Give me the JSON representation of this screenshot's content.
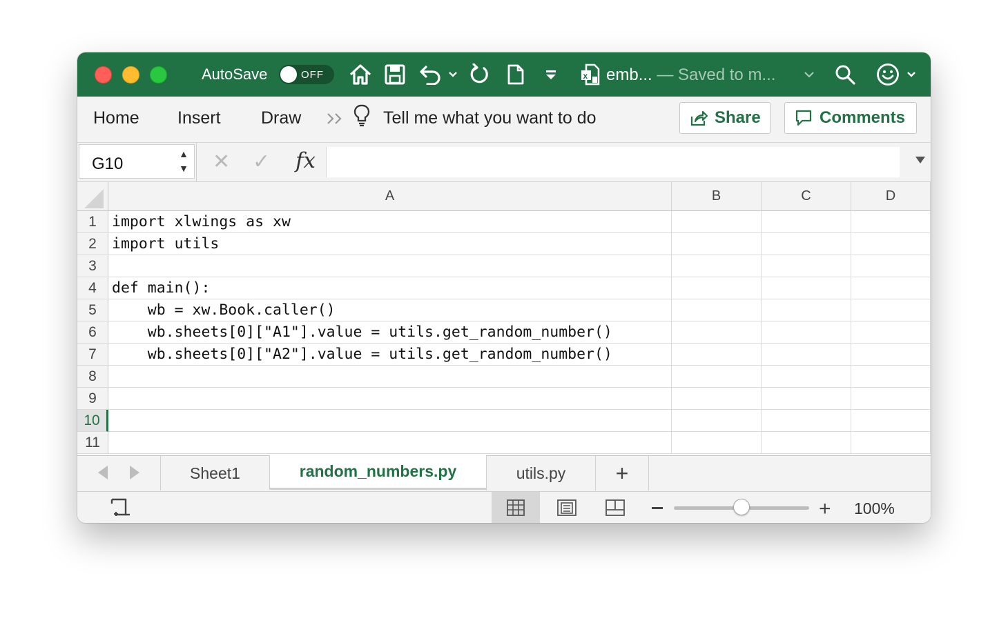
{
  "titlebar": {
    "autosave_label": "AutoSave",
    "autosave_state": "OFF",
    "doc_name": "emb...",
    "doc_status": " — Saved to m...",
    "icons": [
      "home-icon",
      "save-icon",
      "undo-icon",
      "redo-icon",
      "new-document-icon",
      "customize-toolbar-icon",
      "excel-file-icon",
      "search-icon",
      "smiley-feedback-icon"
    ]
  },
  "ribbon": {
    "tabs": [
      "Home",
      "Insert",
      "Draw"
    ],
    "tell_me": "Tell me what you want to do",
    "share_label": "Share",
    "comments_label": "Comments"
  },
  "formula_bar": {
    "name_box": "G10",
    "fx_label": "fx",
    "formula": ""
  },
  "grid": {
    "columns": [
      "A",
      "B",
      "C",
      "D"
    ],
    "rows": [
      "1",
      "2",
      "3",
      "4",
      "5",
      "6",
      "7",
      "8",
      "9",
      "10",
      "11"
    ],
    "selected_row": "10",
    "selected_cell": "G10",
    "cells_a": [
      "import xlwings as xw",
      "import utils",
      "",
      "def main():",
      "    wb = xw.Book.caller()",
      "    wb.sheets[0][\"A1\"].value = utils.get_random_number()",
      "    wb.sheets[0][\"A2\"].value = utils.get_random_number()",
      "",
      "",
      "",
      ""
    ]
  },
  "sheets": {
    "tabs": [
      "Sheet1",
      "random_numbers.py",
      "utils.py"
    ],
    "active": "random_numbers.py",
    "add_label": "+"
  },
  "statusbar": {
    "zoom": "100%",
    "zoom_value": 100,
    "view_modes": [
      "normal-view-icon",
      "page-layout-icon",
      "page-break-icon"
    ]
  },
  "colors": {
    "accent": "#207245",
    "ribbon_bg": "#f3f3f3"
  }
}
